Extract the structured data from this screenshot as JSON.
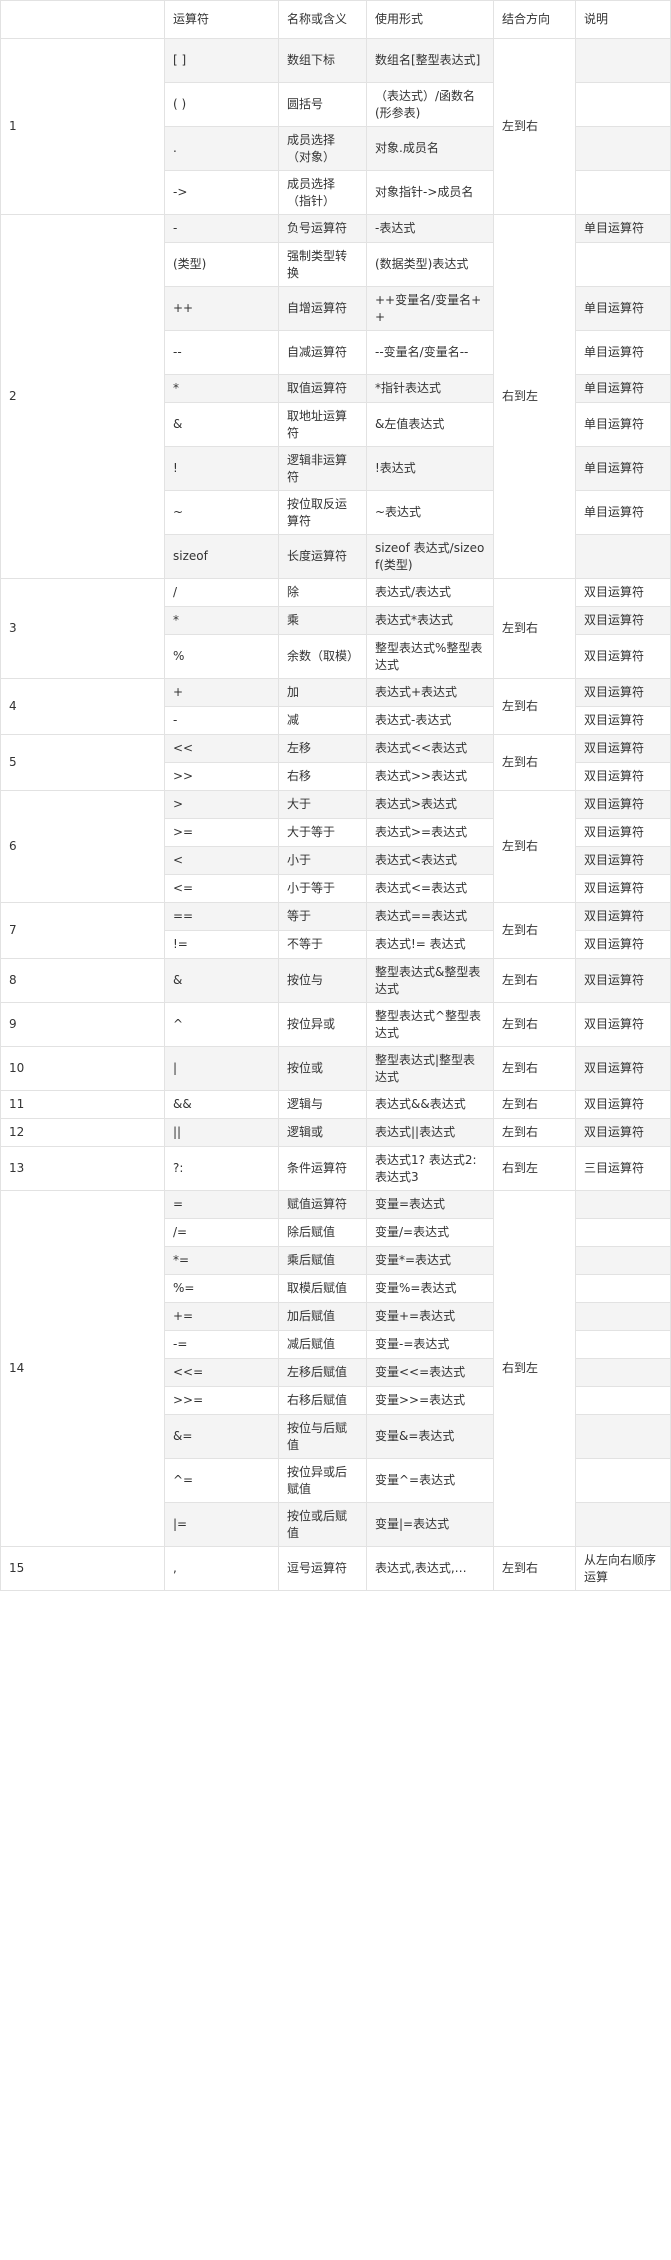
{
  "table": {
    "headers": [
      "",
      "运算符",
      "名称或含义",
      "使用形式",
      "结合方向",
      "说明"
    ],
    "groups": [
      {
        "level": "1",
        "assoc": "左到右",
        "rows": [
          {
            "op": "[ ]",
            "name": "数组下标",
            "usage": "数组名[整型表达式]",
            "note": ""
          },
          {
            "op": "( )",
            "name": "圆括号",
            "usage": "（表达式）/函数名(形参表)",
            "note": ""
          },
          {
            "op": ".",
            "name": "成员选择（对象）",
            "usage": "对象.成员名",
            "note": ""
          },
          {
            "op": "->",
            "name": "成员选择（指针）",
            "usage": "对象指针->成员名",
            "note": ""
          }
        ]
      },
      {
        "level": "2",
        "assoc": "右到左",
        "rows": [
          {
            "op": "-",
            "name": "负号运算符",
            "usage": "-表达式",
            "note": "单目运算符"
          },
          {
            "op": "(类型)",
            "name": "强制类型转换",
            "usage": "(数据类型)表达式",
            "note": ""
          },
          {
            "op": "++",
            "name": "自增运算符",
            "usage": "++变量名/变量名++",
            "note": "单目运算符"
          },
          {
            "op": "--",
            "name": "自减运算符",
            "usage": "--变量名/变量名--",
            "note": "单目运算符"
          },
          {
            "op": "*",
            "name": "取值运算符",
            "usage": "*指针表达式",
            "note": "单目运算符"
          },
          {
            "op": "&",
            "name": "取地址运算符",
            "usage": "&左值表达式",
            "note": "单目运算符"
          },
          {
            "op": "!",
            "name": "逻辑非运算符",
            "usage": "!表达式",
            "note": "单目运算符"
          },
          {
            "op": "~",
            "name": "按位取反运算符",
            "usage": "~表达式",
            "note": "单目运算符"
          },
          {
            "op": "sizeof",
            "name": "长度运算符",
            "usage": "sizeof 表达式/sizeof(类型)",
            "note": ""
          }
        ]
      },
      {
        "level": "3",
        "assoc": "左到右",
        "rows": [
          {
            "op": "/",
            "name": "除",
            "usage": "表达式/表达式",
            "note": "双目运算符"
          },
          {
            "op": "*",
            "name": "乘",
            "usage": "表达式*表达式",
            "note": "双目运算符"
          },
          {
            "op": "%",
            "name": "余数（取模）",
            "usage": "整型表达式%整型表达式",
            "note": "双目运算符"
          }
        ]
      },
      {
        "level": "4",
        "assoc": "左到右",
        "rows": [
          {
            "op": "+",
            "name": "加",
            "usage": "表达式+表达式",
            "note": "双目运算符"
          },
          {
            "op": "-",
            "name": "减",
            "usage": "表达式-表达式",
            "note": "双目运算符"
          }
        ]
      },
      {
        "level": "5",
        "assoc": "左到右",
        "rows": [
          {
            "op": "<<",
            "name": "左移",
            "usage": "表达式<<表达式",
            "note": "双目运算符"
          },
          {
            "op": ">>",
            "name": "右移",
            "usage": "表达式>>表达式",
            "note": "双目运算符"
          }
        ]
      },
      {
        "level": "6",
        "assoc": "左到右",
        "rows": [
          {
            "op": ">",
            "name": "大于",
            "usage": "表达式>表达式",
            "note": "双目运算符"
          },
          {
            "op": ">=",
            "name": "大于等于",
            "usage": "表达式>=表达式",
            "note": "双目运算符"
          },
          {
            "op": "<",
            "name": "小于",
            "usage": "表达式<表达式",
            "note": "双目运算符"
          },
          {
            "op": "<=",
            "name": "小于等于",
            "usage": "表达式<=表达式",
            "note": "双目运算符"
          }
        ]
      },
      {
        "level": "7",
        "assoc": "左到右",
        "rows": [
          {
            "op": "==",
            "name": "等于",
            "usage": "表达式==表达式",
            "note": "双目运算符"
          },
          {
            "op": "!=",
            "name": "不等于",
            "usage": "表达式!= 表达式",
            "note": "双目运算符"
          }
        ]
      },
      {
        "level": "8",
        "assoc": "左到右",
        "rows": [
          {
            "op": "&",
            "name": "按位与",
            "usage": "整型表达式&整型表达式",
            "note": "双目运算符"
          }
        ]
      },
      {
        "level": "9",
        "assoc": "左到右",
        "rows": [
          {
            "op": "^",
            "name": "按位异或",
            "usage": "整型表达式^整型表达式",
            "note": "双目运算符"
          }
        ]
      },
      {
        "level": "10",
        "assoc": "左到右",
        "rows": [
          {
            "op": "|",
            "name": "按位或",
            "usage": "整型表达式|整型表达式",
            "note": "双目运算符"
          }
        ]
      },
      {
        "level": "11",
        "assoc": "左到右",
        "rows": [
          {
            "op": "&&",
            "name": "逻辑与",
            "usage": "表达式&&表达式",
            "note": "双目运算符"
          }
        ]
      },
      {
        "level": "12",
        "assoc": "左到右",
        "rows": [
          {
            "op": "||",
            "name": "逻辑或",
            "usage": "表达式||表达式",
            "note": "双目运算符"
          }
        ]
      },
      {
        "level": "13",
        "assoc": "右到左",
        "rows": [
          {
            "op": "?:",
            "name": "条件运算符",
            "usage": "表达式1? 表达式2: 表达式3",
            "note": "三目运算符"
          }
        ]
      },
      {
        "level": "14",
        "assoc": "右到左",
        "rows": [
          {
            "op": "=",
            "name": "赋值运算符",
            "usage": "变量=表达式",
            "note": ""
          },
          {
            "op": "/=",
            "name": "除后赋值",
            "usage": "变量/=表达式",
            "note": ""
          },
          {
            "op": "*=",
            "name": "乘后赋值",
            "usage": "变量*=表达式",
            "note": ""
          },
          {
            "op": "%=",
            "name": "取模后赋值",
            "usage": "变量%=表达式",
            "note": ""
          },
          {
            "op": "+=",
            "name": "加后赋值",
            "usage": "变量+=表达式",
            "note": ""
          },
          {
            "op": "-=",
            "name": "减后赋值",
            "usage": "变量-=表达式",
            "note": ""
          },
          {
            "op": "<<=",
            "name": "左移后赋值",
            "usage": "变量<<=表达式",
            "note": ""
          },
          {
            "op": ">>=",
            "name": "右移后赋值",
            "usage": "变量>>=表达式",
            "note": ""
          },
          {
            "op": "&=",
            "name": "按位与后赋值",
            "usage": "变量&=表达式",
            "note": ""
          },
          {
            "op": "^=",
            "name": "按位异或后赋值",
            "usage": "变量^=表达式",
            "note": ""
          },
          {
            "op": "|=",
            "name": "按位或后赋值",
            "usage": "变量|=表达式",
            "note": ""
          }
        ]
      },
      {
        "level": "15",
        "assoc": "左到右",
        "rows": [
          {
            "op": ",",
            "name": "逗号运算符",
            "usage": "表达式,表达式,…",
            "note": "从左向右顺序运算"
          }
        ]
      }
    ]
  }
}
